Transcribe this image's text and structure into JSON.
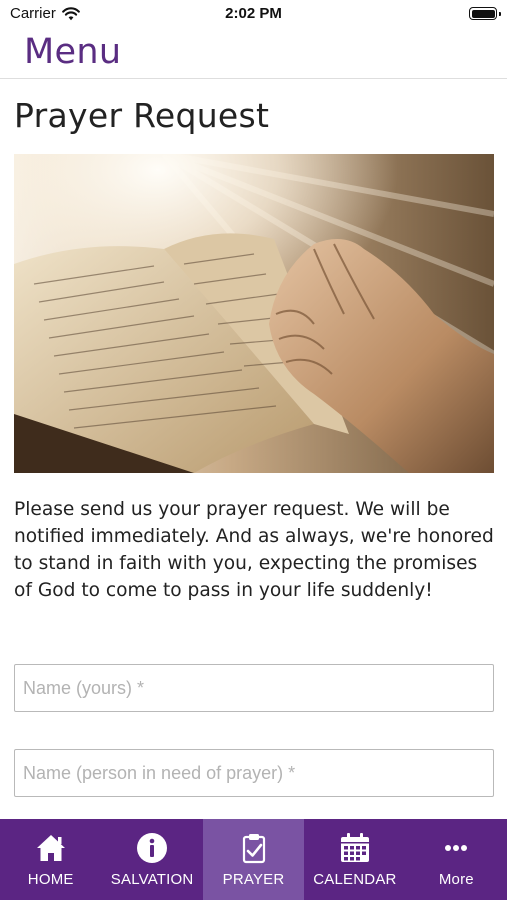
{
  "status_bar": {
    "carrier": "Carrier",
    "time": "2:02 PM"
  },
  "header": {
    "menu_label": "Menu"
  },
  "page": {
    "title": "Prayer Request",
    "intro": "Please send us your prayer request. We will be notified immediately. And as always, we're honored to stand in faith with you, expecting the promises of God to come to pass in your life suddenly!",
    "fields": {
      "name_placeholder": "Name (yours) *",
      "person_placeholder": "Name (person in need of prayer) *"
    }
  },
  "tab_bar": {
    "active_tab": "PRAYER",
    "tabs": [
      {
        "label": "HOME",
        "icon": "home-icon"
      },
      {
        "label": "SALVATION",
        "icon": "info-icon"
      },
      {
        "label": "PRAYER",
        "icon": "clipboard-check-icon"
      },
      {
        "label": "CALENDAR",
        "icon": "calendar-icon"
      },
      {
        "label": "More",
        "icon": "more-icon"
      }
    ]
  },
  "colors": {
    "brand_purple": "#5b2583",
    "active_tab": "#7a53a3",
    "menu_text": "#5a2d82"
  }
}
